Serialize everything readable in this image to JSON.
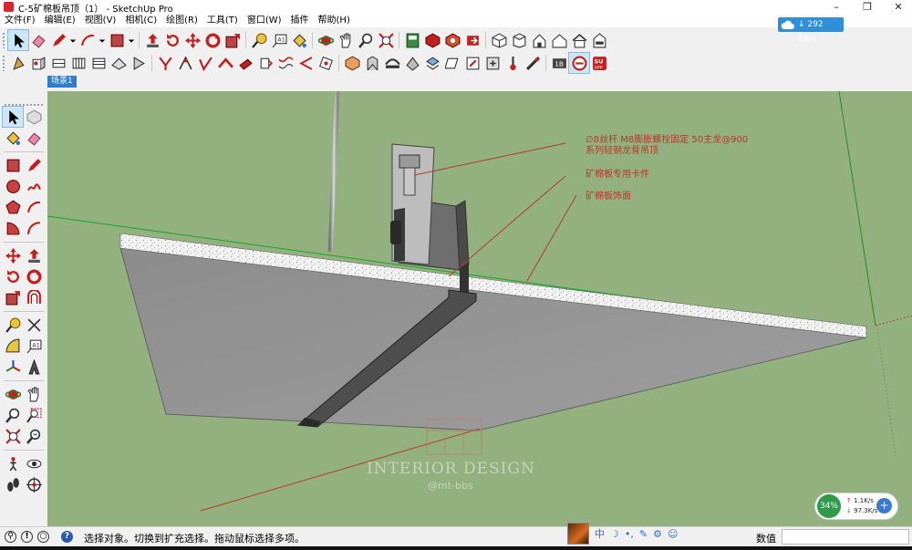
{
  "window": {
    "title": "C-5矿棉板吊顶（1） - SketchUp Pro",
    "minimize": "–",
    "maximize": "❐",
    "close": "✕"
  },
  "menu": [
    "文件(F)",
    "编辑(E)",
    "视图(V)",
    "相机(C)",
    "绘图(R)",
    "工具(T)",
    "窗口(W)",
    "插件",
    "帮助(H)"
  ],
  "network": {
    "speed": "292 KB/s"
  },
  "scene": {
    "tab_label": "场景1"
  },
  "toolbar_row1": [
    "select-icon",
    "eraser-icon",
    "pencil-icon",
    "dropdown-icon",
    "arc-icon",
    "dropdown-icon",
    "rectangle-icon",
    "dropdown-icon",
    "push-pull-icon",
    "rotate-icon",
    "move-icon",
    "follow-me-icon",
    "scale-icon",
    "offset-icon",
    "tape-measure-icon",
    "text-icon",
    "paint-bucket-icon",
    "orbit-icon",
    "pan-icon",
    "zoom-icon",
    "zoom-extents-icon",
    "model-info-icon",
    "get-models-icon",
    "share-model-icon",
    "extension-warehouse-icon",
    "iso-view-icon",
    "top-view-icon",
    "front-view-icon",
    "right-view-icon",
    "back-view-icon",
    "left-view-icon"
  ],
  "toolbar_row2": [
    "plugin-1-icon",
    "plugin-2-icon",
    "plugin-3-icon",
    "plugin-4-icon",
    "plugin-5-icon",
    "plugin-6-icon",
    "plugin-7-icon",
    "plugin-8-icon",
    "plugin-9-icon",
    "plugin-10-icon",
    "plugin-11-icon",
    "plugin-12-icon",
    "plugin-13-icon",
    "plugin-14-icon",
    "plugin-15-icon",
    "plugin-16-icon",
    "plugin-17-icon",
    "plugin-18-icon",
    "plugin-19-icon",
    "plugin-20-icon",
    "plugin-21-icon",
    "plugin-22-icon",
    "plugin-23-icon",
    "plugin-24-icon",
    "plugin-25-icon",
    "plugin-26-icon",
    "plugin-27-icon",
    "plugin-28-icon"
  ],
  "palette": [
    "select-icon",
    "component-icon",
    "paint-bucket-icon",
    "eraser-icon",
    "rectangle-icon",
    "line-icon",
    "circle-icon",
    "freehand-icon",
    "polygon-icon",
    "arc-icon",
    "pie-icon",
    "arc2-icon",
    "move-icon",
    "push-pull-icon",
    "rotate-icon",
    "follow-me-icon",
    "scale-icon",
    "offset-icon",
    "tape-measure-icon",
    "dimension-icon",
    "protractor-icon",
    "text-icon",
    "axes-icon",
    "3d-text-icon",
    "orbit-icon",
    "pan-icon",
    "zoom-icon",
    "zoom-window-icon",
    "zoom-extents-icon",
    "previous-view-icon",
    "position-camera-icon",
    "look-around-icon",
    "walk-icon",
    "section-plane-icon"
  ],
  "annotations": {
    "line1": "∅8丝杆 M8膨胀螺栓固定 50主龙@900",
    "line2": "系列轻钢龙骨吊顶",
    "clip": "矿棉板专用卡件",
    "board": "矿棉板饰面"
  },
  "watermark": {
    "main": "INTERIOR DESIGN",
    "sub": "@mt-bbs"
  },
  "speed_widget": {
    "percent": "34%",
    "up": "1.1K/s",
    "down": "97.3K/s",
    "up_arrow": "↑",
    "down_arrow": "↓"
  },
  "status": {
    "hint": "选择对象。切换到扩充选择。拖动鼠标选择多项。",
    "measure_label": "数值",
    "icons": [
      "⚲",
      "!",
      "○",
      "?"
    ]
  },
  "ime": {
    "items": [
      "中",
      "☽",
      "•,",
      "✎",
      "⚙",
      "☺"
    ]
  },
  "colors": {
    "viewport": "#93b17f",
    "annotation": "#b33a2a",
    "accent": "#2e7ec9"
  }
}
